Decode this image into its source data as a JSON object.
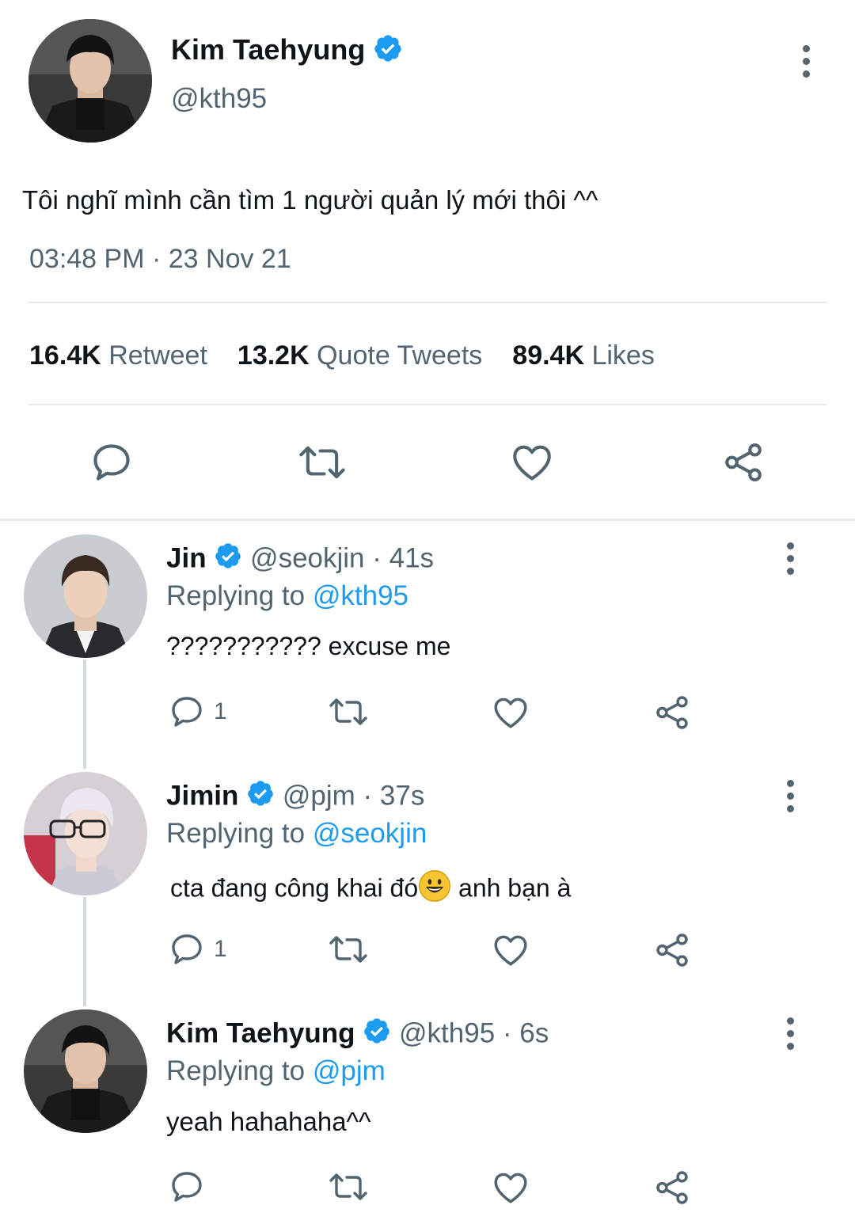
{
  "main_tweet": {
    "author_name": "Kim Taehyung",
    "handle": "@kth95",
    "text": "Tôi nghĩ mình cần tìm 1 người quản lý mới thôi ^^",
    "timestamp": "03:48 PM · 23 Nov 21",
    "stats": {
      "retweets_count": "16.4K",
      "retweets_label": "Retweet",
      "quotes_count": "13.2K",
      "quotes_label": "Quote Tweets",
      "likes_count": "89.4K",
      "likes_label": "Likes"
    }
  },
  "replies": [
    {
      "author_name": "Jin",
      "handle_time": "@seokjin · 41s",
      "replying_label": "Replying to",
      "replying_to": "@kth95",
      "text": "??????????? excuse me",
      "reply_count": "1"
    },
    {
      "author_name": "Jimin",
      "handle_time": "@pjm · 37s",
      "replying_label": "Replying to",
      "replying_to": "@seokjin",
      "text_before_emoji": "cta đang công khai đó",
      "text_after_emoji": " anh bạn à",
      "reply_count": "1"
    },
    {
      "author_name": "Kim Taehyung",
      "handle_time": "@kth95 · 6s",
      "replying_label": "Replying to",
      "replying_to": "@pjm",
      "text": "yeah hahahaha^^",
      "reply_count": ""
    }
  ],
  "colors": {
    "accent": "#1d9bf0",
    "muted_text": "#536471",
    "divider": "#e6e9ec"
  },
  "icons": [
    "verified-badge-icon",
    "more-options-icon",
    "reply-icon",
    "retweet-icon",
    "like-icon",
    "share-icon",
    "smiley-emoji-icon"
  ]
}
